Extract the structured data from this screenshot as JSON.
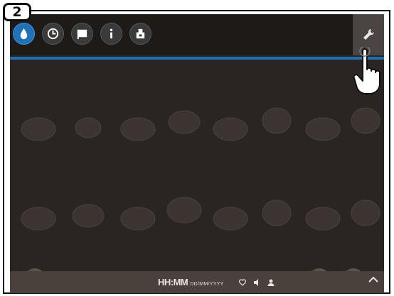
{
  "step": {
    "number": "2"
  },
  "toolbar": {
    "icons": [
      {
        "name": "water-drop-icon",
        "active": true
      },
      {
        "name": "clock-icon",
        "active": false
      },
      {
        "name": "flag-icon",
        "active": false
      },
      {
        "name": "info-icon",
        "active": false
      },
      {
        "name": "maintenance-icon",
        "active": false
      }
    ],
    "settings_icon": "wrench-icon"
  },
  "status_bar": {
    "time_format": "HH:MM",
    "date_format": "DD/MM/YYYY"
  },
  "colors": {
    "accent": "#1f6fb0",
    "active_icon": "#1f72b8",
    "screen_bg": "#2a2523"
  }
}
